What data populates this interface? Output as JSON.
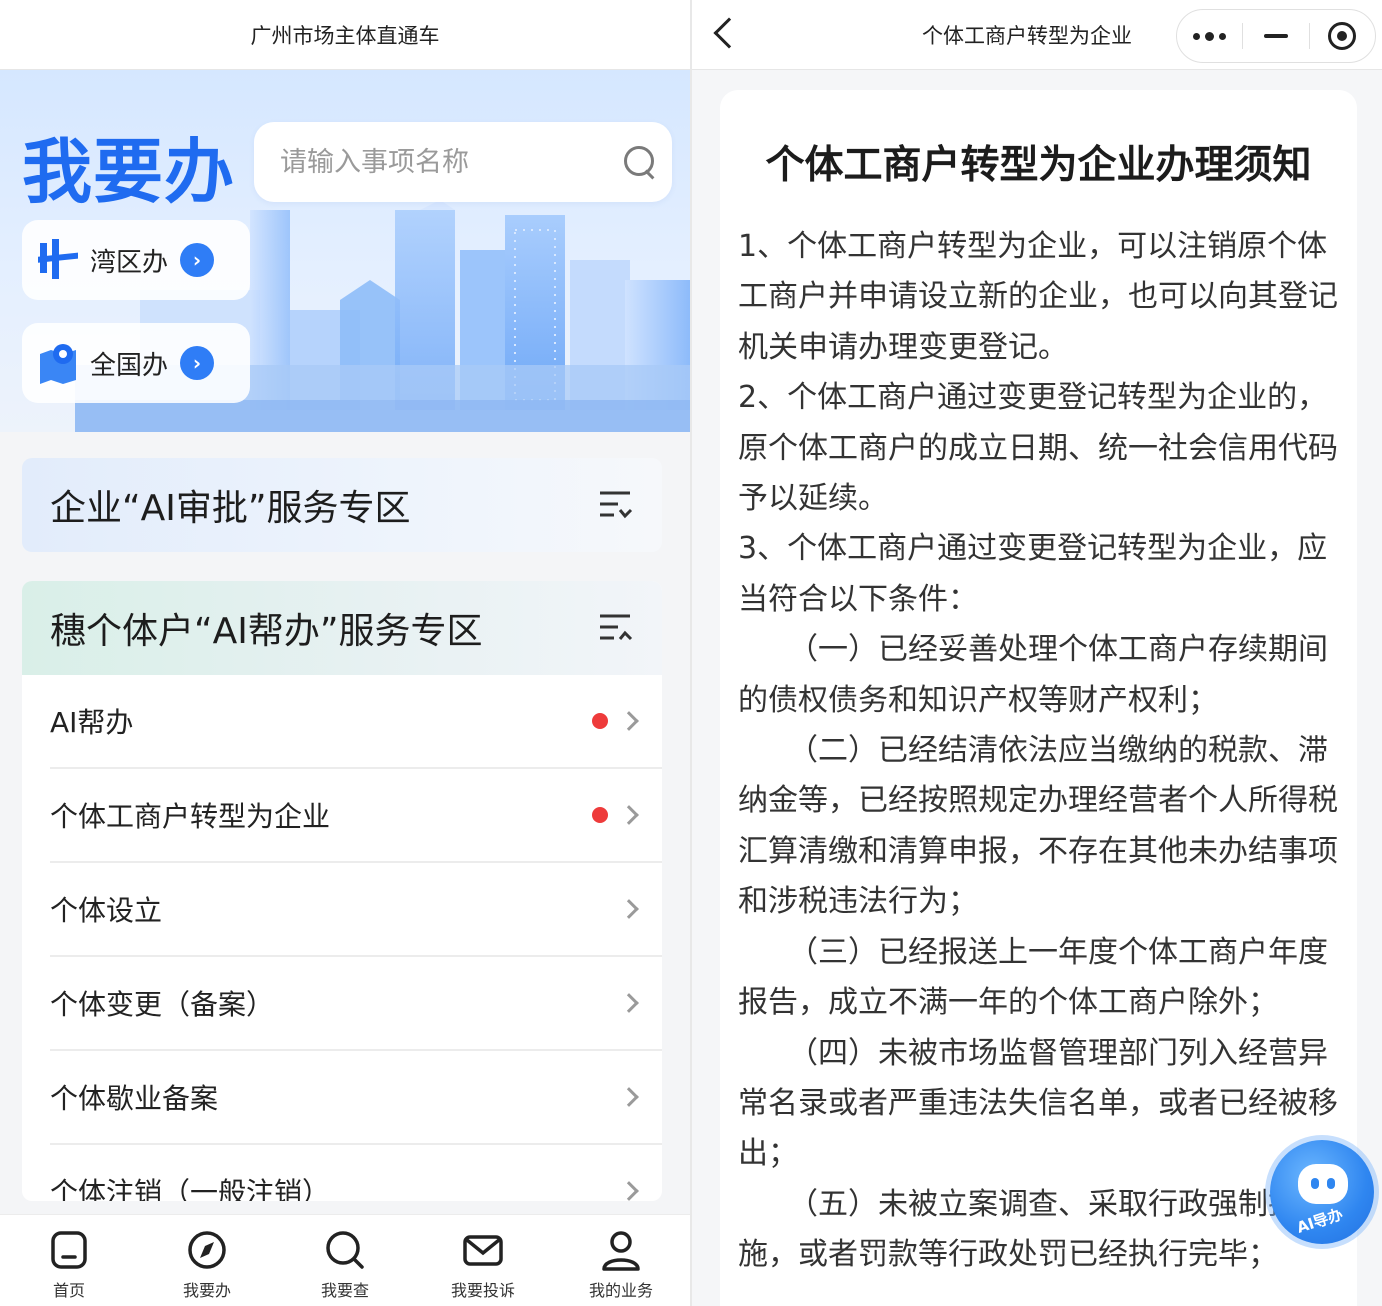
{
  "left": {
    "window_title": "广州市场主体直通车",
    "hero": {
      "title": "我要办",
      "search_placeholder": "请输入事项名称",
      "buttons": [
        {
          "label": "湾区办",
          "icon": "bay-area-icon"
        },
        {
          "label": "全国办",
          "icon": "map-pin-icon"
        }
      ]
    },
    "zone_ai_approval": {
      "title": "企业“AI审批”服务专区"
    },
    "zone_ai_help": {
      "title": "穗个体户“AI帮办”服务专区",
      "items": [
        {
          "label": "AI帮办",
          "badge": true
        },
        {
          "label": "个体工商户转型为企业",
          "badge": true
        },
        {
          "label": "个体设立",
          "badge": false
        },
        {
          "label": "个体变更（备案）",
          "badge": false
        },
        {
          "label": "个体歇业备案",
          "badge": false
        },
        {
          "label": "个体注销（一般注销）",
          "badge": false
        }
      ]
    },
    "tabbar": [
      {
        "label": "首页",
        "icon": "home-icon"
      },
      {
        "label": "我要办",
        "icon": "compass-icon"
      },
      {
        "label": "我要查",
        "icon": "search-icon"
      },
      {
        "label": "我要投诉",
        "icon": "mail-icon"
      },
      {
        "label": "我的业务",
        "icon": "user-icon"
      }
    ]
  },
  "right": {
    "window_title": "个体工商户转型为企业",
    "notice": {
      "title": "个体工商户转型为企业办理须知",
      "paragraphs": [
        "1、个体工商户转型为企业，可以注销原个体工商户并申请设立新的企业，也可以向其登记机关申请办理变更登记。",
        "2、个体工商户通过变更登记转型为企业的，原个体工商户的成立日期、统一社会信用代码予以延续。",
        "3、个体工商户通过变更登记转型为企业，应当符合以下条件：",
        "（一）已经妥善处理个体工商户存续期间的债权债务和知识产权等财产权利；",
        "（二）已经结清依法应当缴纳的税款、滞纳金等，已经按照规定办理经营者个人所得税汇算清缴和清算申报，不存在其他未办结事项和涉税违法行为；",
        "（三）已经报送上一年度个体工商户年度报告，成立不满一年的个体工商户除外；",
        "（四）未被市场监督管理部门列入经营异常名录或者严重违法失信名单，或者已经被移出；",
        "（五）未被立案调查、采取行政强制措施，或者罚款等行政处罚已经执行完毕；"
      ]
    },
    "ai_guide_label": "AI导办"
  },
  "colors": {
    "accent": "#1f6bf0",
    "badge_red": "#ee3b3b",
    "ai_button": "#2f86f0"
  }
}
